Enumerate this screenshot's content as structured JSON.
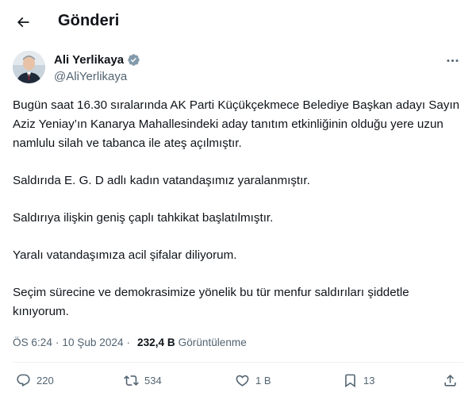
{
  "header": {
    "title": "Gönderi",
    "back_icon": "arrow-left-icon"
  },
  "author": {
    "name": "Ali Yerlikaya",
    "handle": "@AliYerlikaya",
    "verified_color": "#829aab"
  },
  "tweet": {
    "paragraphs": [
      "Bugün saat 16.30 sıralarında AK Parti Küçükçekmece Belediye Başkan adayı Sayın Aziz Yeniay’ın Kanarya Mahallesindeki aday tanıtım etkinliğinin olduğu yere uzun namlulu silah ve tabanca ile ateş açılmıştır.",
      "Saldırıda E. G. D adlı kadın vatandaşımız yaralanmıştır.",
      "Saldırıya ilişkin geniş çaplı tahkikat başlatılmıştır.",
      "Yaralı vatandaşımıza acil şifalar diliyorum.",
      "Seçim sürecine ve demokrasimize yönelik bu tür menfur saldırıları şiddetle kınıyorum."
    ]
  },
  "meta": {
    "time": "ÖS 6:24",
    "separator": "·",
    "date": "10 Şub 2024",
    "views": "232,4 B",
    "views_label": "Görüntülenme"
  },
  "actions": {
    "replies": "220",
    "reposts": "534",
    "likes": "1 B",
    "bookmarks": "13"
  },
  "colors": {
    "text": "#0f1419",
    "secondary": "#536471",
    "divider": "#eff3f4"
  }
}
